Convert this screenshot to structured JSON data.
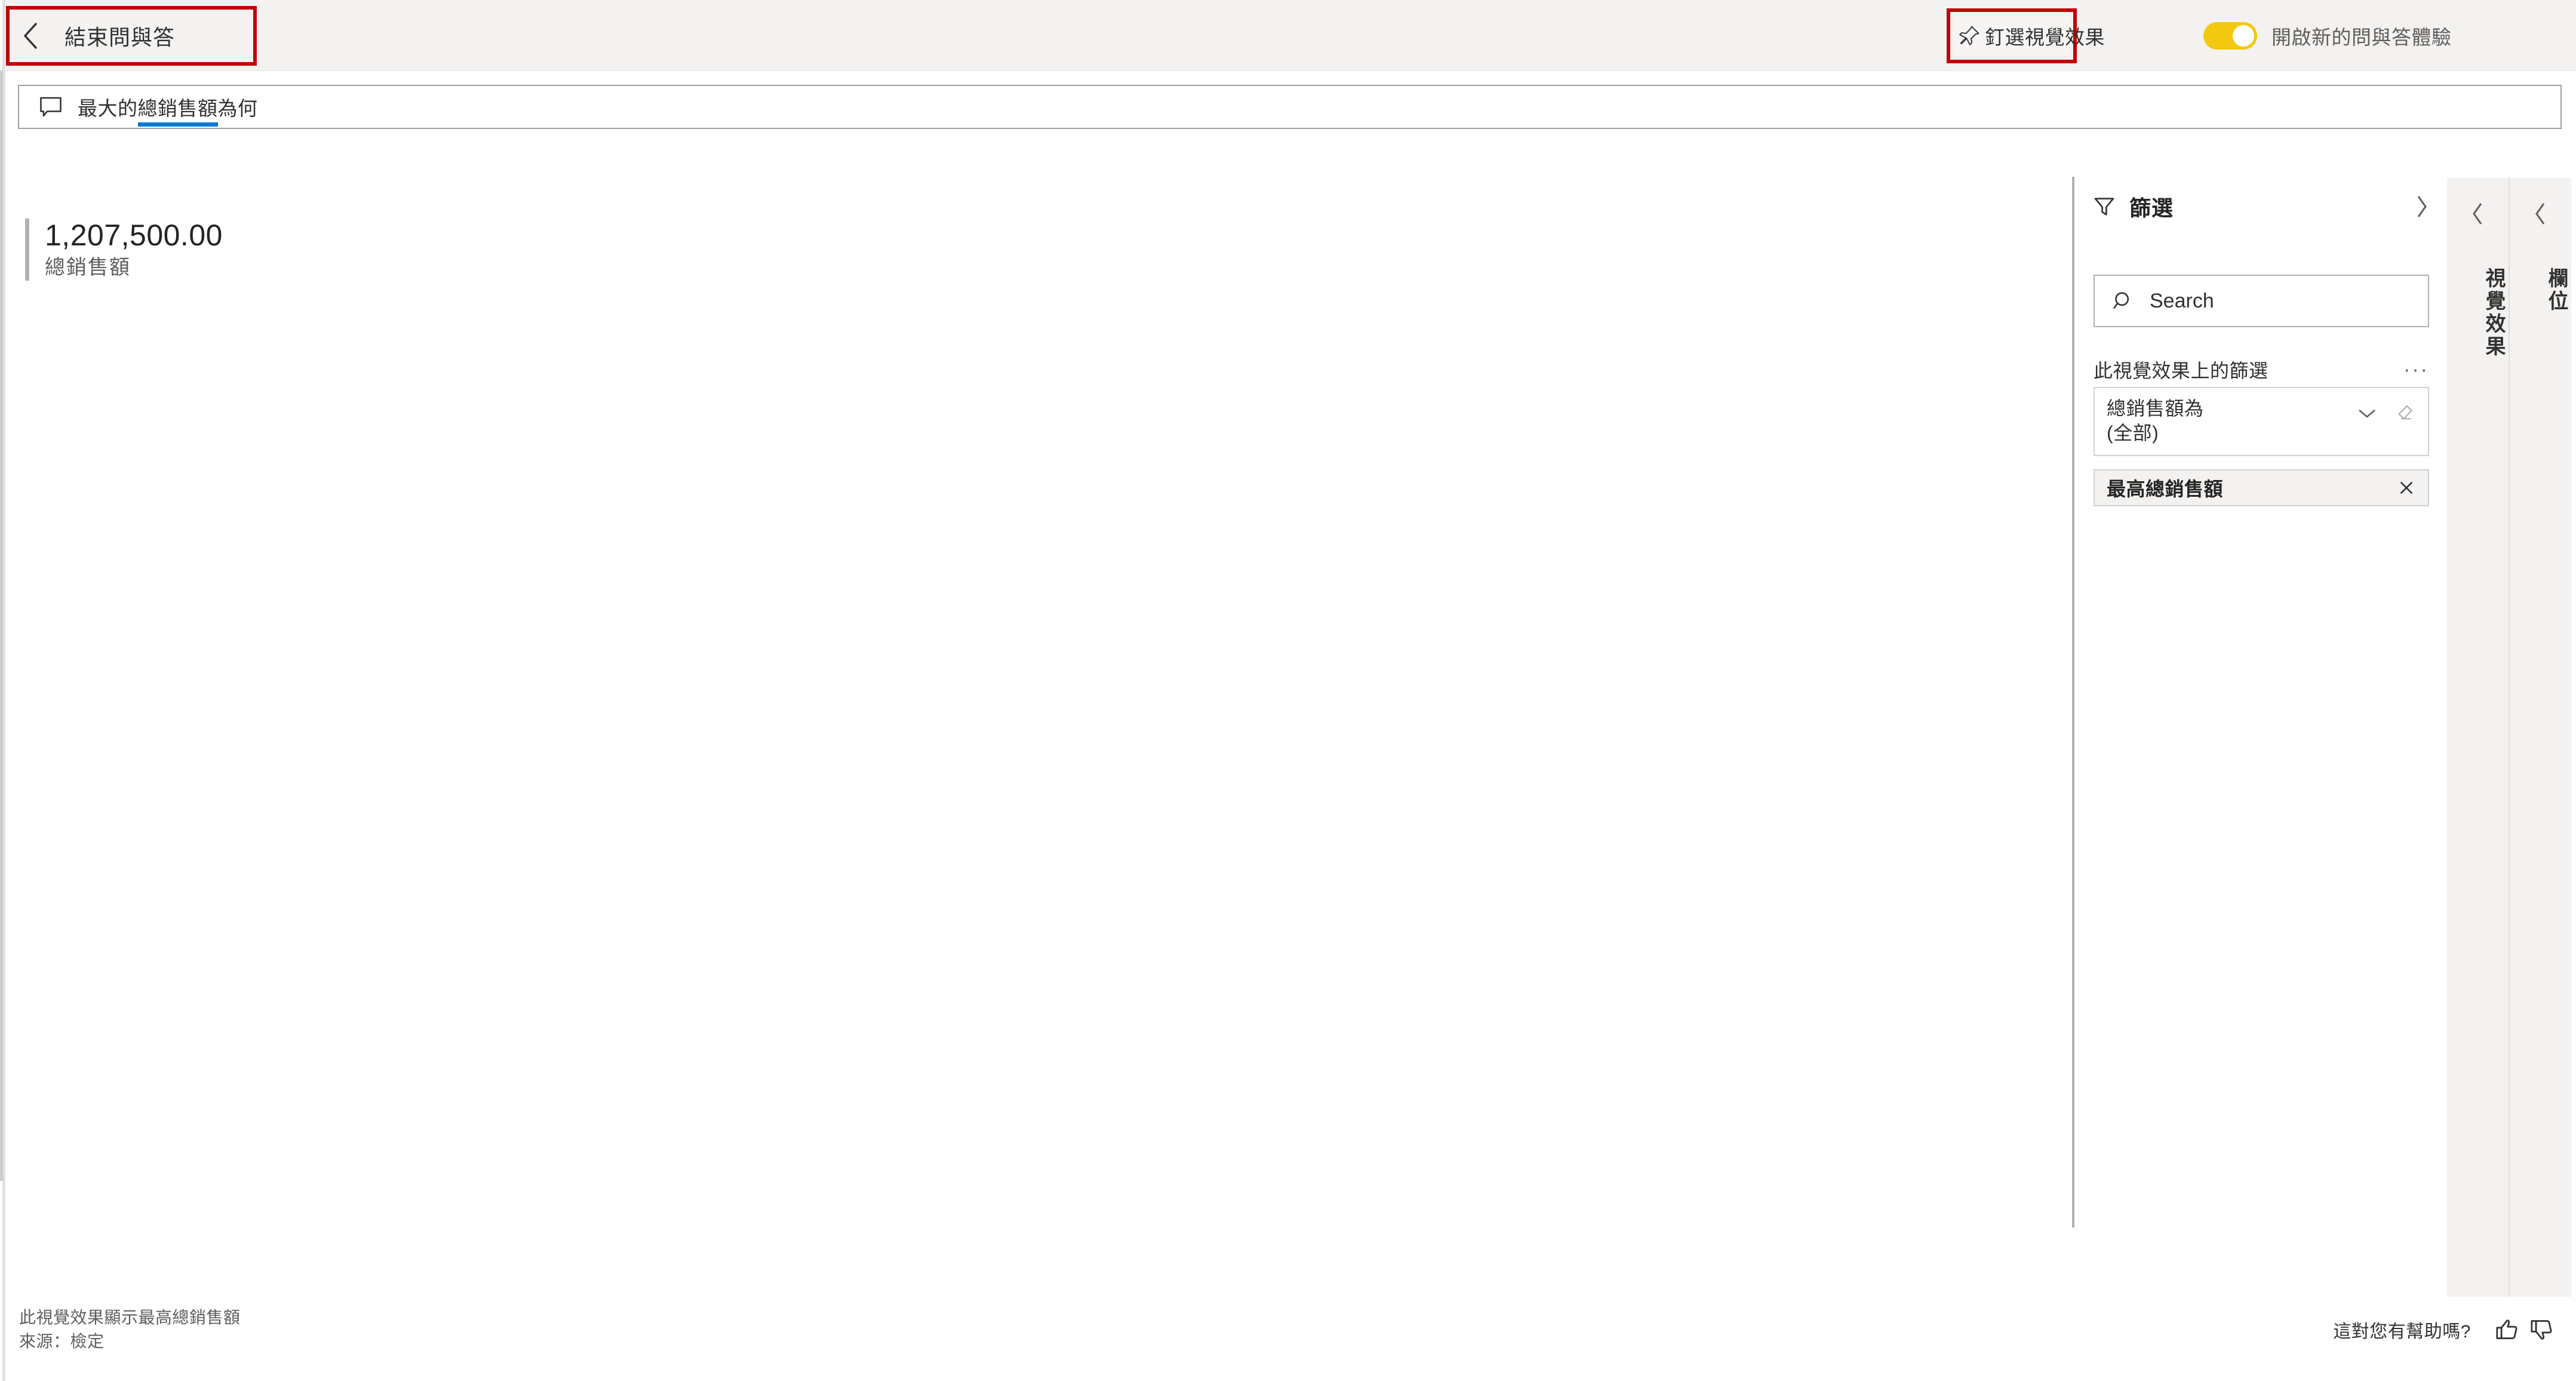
{
  "header": {
    "exit_button": {
      "label": "結束問與答",
      "icon": "chevron-left-icon",
      "annotated": true,
      "annotation_color": "#C00000"
    },
    "pin_button": {
      "label": "釘選視覺效果",
      "icon": "pin-icon",
      "annotated": true,
      "annotation_color": "#C00000"
    },
    "toggle": {
      "label": "開啟新的問與答體驗",
      "state": "on",
      "color": "#F2C811"
    }
  },
  "question_bar": {
    "icon": "comment-icon",
    "text_before": "最大的",
    "text_highlighted": "總銷售額",
    "text_after": "為何",
    "highlight_color": "#0078D4"
  },
  "canvas": {
    "kpi_card": {
      "value": "1,207,500.00",
      "label": "總銷售額",
      "accent_color": "#B3B0AD"
    }
  },
  "filters_pane": {
    "title": "篩選",
    "funnel_icon": "filter-funnel-icon",
    "collapse_icon": "chevron-right-icon",
    "search": {
      "placeholder": "Search",
      "icon": "search-icon"
    },
    "section_label": "此視覺效果上的篩選",
    "more_options": "···",
    "filter_card": {
      "line1": "總銷售額為",
      "line2": "(全部)",
      "expand_icon": "chevron-down-icon",
      "erase_icon": "eraser-icon"
    },
    "filter_chip": {
      "label": "最高總銷售額",
      "close_icon": "close-icon"
    }
  },
  "right_panels": [
    {
      "label": "視覺效果",
      "collapse_icon": "chevron-left-icon"
    },
    {
      "label": "欄位",
      "collapse_icon": "chevron-left-icon"
    }
  ],
  "footer": {
    "note_line1": "此視覺效果顯示最高總銷售額",
    "note_line2": "來源：檢定",
    "feedback_text": "這對您有幫助嗎?",
    "thumbs_up_icon": "thumbs-up-icon",
    "thumbs_down_icon": "thumbs-down-icon"
  }
}
